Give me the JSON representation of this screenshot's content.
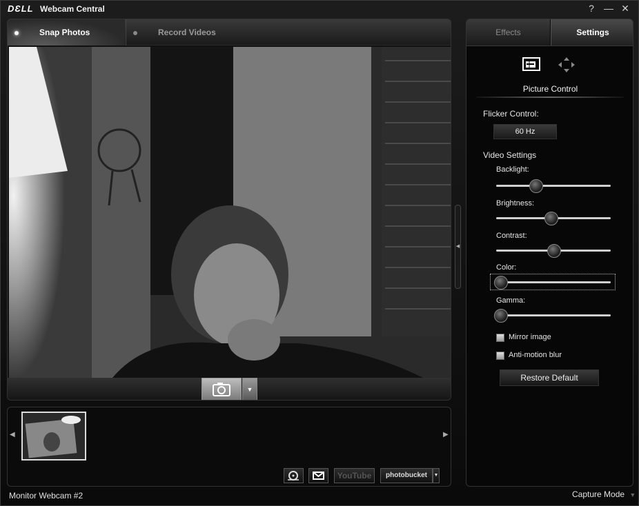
{
  "window": {
    "brand": "DƐLL",
    "title": "Webcam Central",
    "controls": {
      "help": "?",
      "minimize": "—",
      "close": "✕"
    }
  },
  "mode_tabs": [
    {
      "label": "Snap Photos",
      "active": true
    },
    {
      "label": "Record Videos",
      "active": false
    }
  ],
  "capture": {
    "dropdown_glyph": "▼"
  },
  "thumbnails": {
    "count": 1,
    "prev_glyph": "◀",
    "next_glyph": "▶"
  },
  "share": {
    "youtube": "YouTube",
    "photobucket": "photobucket",
    "dropdown_glyph": "▼"
  },
  "status": {
    "device": "Monitor Webcam #2",
    "mode": "Capture Mode",
    "mode_glyph": "▼"
  },
  "collapse_glyph": "◀",
  "right_tabs": [
    {
      "label": "Effects",
      "active": false
    },
    {
      "label": "Settings",
      "active": true
    }
  ],
  "settings": {
    "section_title": "Picture Control",
    "flicker_label": "Flicker Control:",
    "flicker_value": "60 Hz",
    "video_label": "Video Settings",
    "sliders": [
      {
        "label": "Backlight:",
        "value": 0.35
      },
      {
        "label": "Brightness:",
        "value": 0.5
      },
      {
        "label": "Contrast:",
        "value": 0.53
      },
      {
        "label": "Color:",
        "value": 0.0
      },
      {
        "label": "Gamma:",
        "value": 0.0
      }
    ],
    "checkboxes": [
      {
        "label": "Mirror image",
        "checked": false
      },
      {
        "label": "Anti-motion blur",
        "checked": false
      }
    ],
    "restore_label": "Restore Default"
  }
}
